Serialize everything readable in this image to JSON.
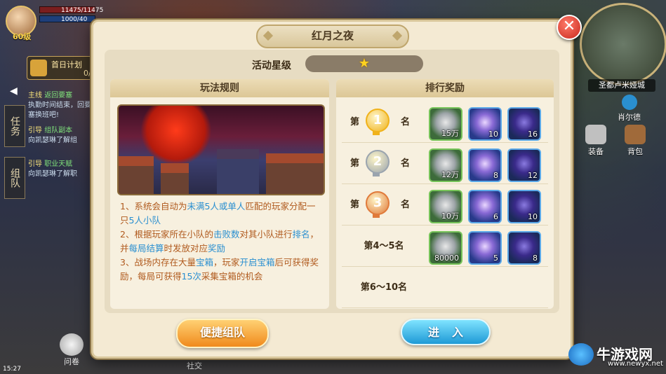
{
  "hud": {
    "hp": "11475/11475",
    "mp": "1000/40",
    "level": "60级",
    "daily": "首日计划",
    "daily_progress": "0/",
    "tab_task": "任务",
    "tab_team": "组队",
    "quests": [
      {
        "tag": "主线",
        "title": "返回要塞",
        "desc": "执勤时间结束，回要塞换班吧!"
      },
      {
        "tag": "引导",
        "title": "组队副本",
        "desc": "向凯瑟琳了解组"
      },
      {
        "tag": "引导",
        "title": "职业天赋",
        "desc": "向凯瑟琳了解职"
      }
    ],
    "scroll_label": "问卷",
    "clock": "15:27",
    "social": "社交"
  },
  "right_hud": {
    "map_name": "圣都卢米娅城",
    "equip": "装备",
    "bag": "背包",
    "npc": "肖尔德"
  },
  "modal": {
    "title": "红月之夜",
    "star_label": "活动星级",
    "star_count": 1,
    "rules_header": "玩法规则",
    "rewards_header": "排行奖励",
    "rules": [
      [
        {
          "t": "1、系统会自动为"
        },
        {
          "t": "未满5人或单人",
          "h": true
        },
        {
          "t": "匹配的玩家分配一只"
        },
        {
          "t": "5人小队",
          "h": true
        }
      ],
      [
        {
          "t": "2、根据玩家所在小队的"
        },
        {
          "t": "击败数",
          "h": true
        },
        {
          "t": "对其小队进行"
        },
        {
          "t": "排名",
          "h": true
        },
        {
          "t": "，并"
        },
        {
          "t": "每局结算",
          "h": true
        },
        {
          "t": "时发放对应"
        },
        {
          "t": "奖励",
          "h": true
        }
      ],
      [
        {
          "t": "3、战场内存在大量"
        },
        {
          "t": "宝箱",
          "h": true
        },
        {
          "t": "，玩家"
        },
        {
          "t": "开启宝箱",
          "h": true
        },
        {
          "t": "后可获得奖励，每局可获得"
        },
        {
          "t": "15次",
          "h": true
        },
        {
          "t": "采集宝箱的机会"
        }
      ]
    ],
    "ranks": [
      {
        "di": "第",
        "num": "1",
        "ming": "名",
        "items": [
          "15万",
          "10",
          "16"
        ]
      },
      {
        "di": "第",
        "num": "2",
        "ming": "名",
        "items": [
          "12万",
          "8",
          "12"
        ]
      },
      {
        "di": "第",
        "num": "3",
        "ming": "名",
        "items": [
          "10万",
          "6",
          "10"
        ]
      },
      {
        "range": "第4～5名",
        "items": [
          "80000",
          "5",
          "8"
        ]
      },
      {
        "range": "第6～10名",
        "items": []
      }
    ],
    "btn_team": "便捷组队",
    "btn_enter": "进入",
    "close": "✕"
  },
  "colors": {
    "highlight": "#2a8fd0",
    "rule_text": "#b05a1e",
    "gold_medal": "#f0b21a",
    "silver_medal": "#9aa4ae",
    "bronze_medal": "#e07a3a"
  },
  "watermark": {
    "text": "牛游戏网",
    "url": "www.newyx.net"
  }
}
